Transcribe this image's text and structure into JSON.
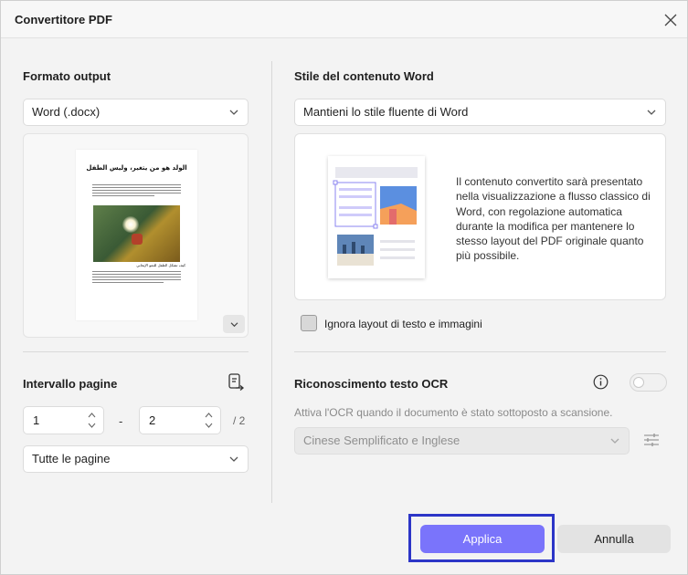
{
  "dialog": {
    "title": "Convertitore PDF"
  },
  "left": {
    "output_format": {
      "label": "Formato output",
      "selected": "Word (.docx)"
    },
    "preview": {
      "page_title": "الولد هو من يتغير، وليس الطفل",
      "caption": "كيف تشكل الطفل للنمو الإيجابي"
    },
    "page_range": {
      "label": "Intervallo pagine",
      "from": "1",
      "separator": "-",
      "to": "2",
      "total": "/ 2",
      "pages_selected": "Tutte le pagine"
    }
  },
  "right": {
    "word_style": {
      "label": "Stile del contenuto Word",
      "selected": "Mantieni lo stile fluente di Word",
      "description": "Il contenuto convertito sarà presentato nella visualizzazione a flusso classico di Word, con regolazione automatica durante la modifica per mantenere lo stesso layout del PDF originale quanto più possibile."
    },
    "ignore_layout": {
      "label": "Ignora layout di testo e immagini",
      "checked": false
    },
    "ocr": {
      "label": "Riconoscimento testo OCR",
      "enabled": false,
      "hint": "Attiva l'OCR quando il documento è stato sottoposto a scansione.",
      "language": "Cinese Semplificato e Inglese"
    }
  },
  "footer": {
    "apply_label": "Applica",
    "cancel_label": "Annulla"
  },
  "colors": {
    "accent": "#7a74fb",
    "focus_ring": "#2c35c7",
    "illustration_blue": "#5b8fe0",
    "illustration_orange": "#f5a05a"
  }
}
